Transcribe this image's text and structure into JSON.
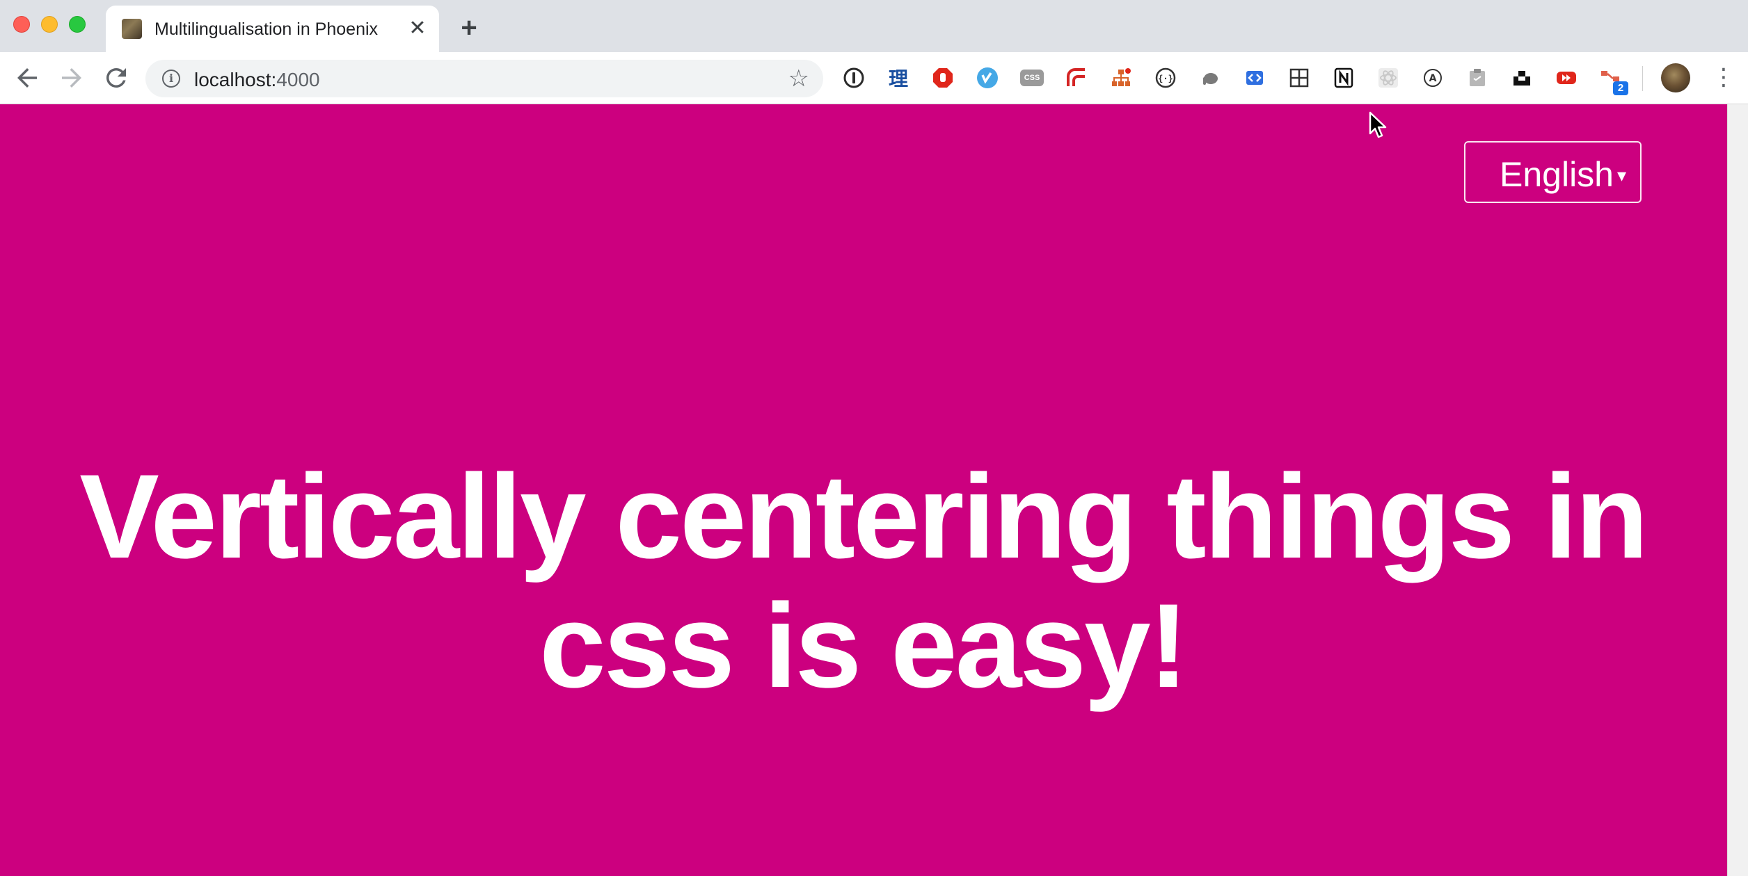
{
  "browser": {
    "tab": {
      "title": "Multilingualisation in Phoenix",
      "close_glyph": "✕"
    },
    "new_tab_glyph": "+",
    "address": {
      "host": "localhost:",
      "port": "4000"
    },
    "icons": {
      "back": "back-arrow-icon",
      "forward": "forward-arrow-icon",
      "reload": "reload-icon",
      "info": "info-icon",
      "bookmark": "star-icon",
      "menu": "kebab-menu-icon"
    },
    "extension_badge": "2",
    "extension_theri_label": "理",
    "extension_css_label": "CSS"
  },
  "page": {
    "background_color": "#cc007f",
    "language_select": {
      "value": "English",
      "caret": "▾"
    },
    "headline": "Vertically centering things in css is easy!"
  }
}
